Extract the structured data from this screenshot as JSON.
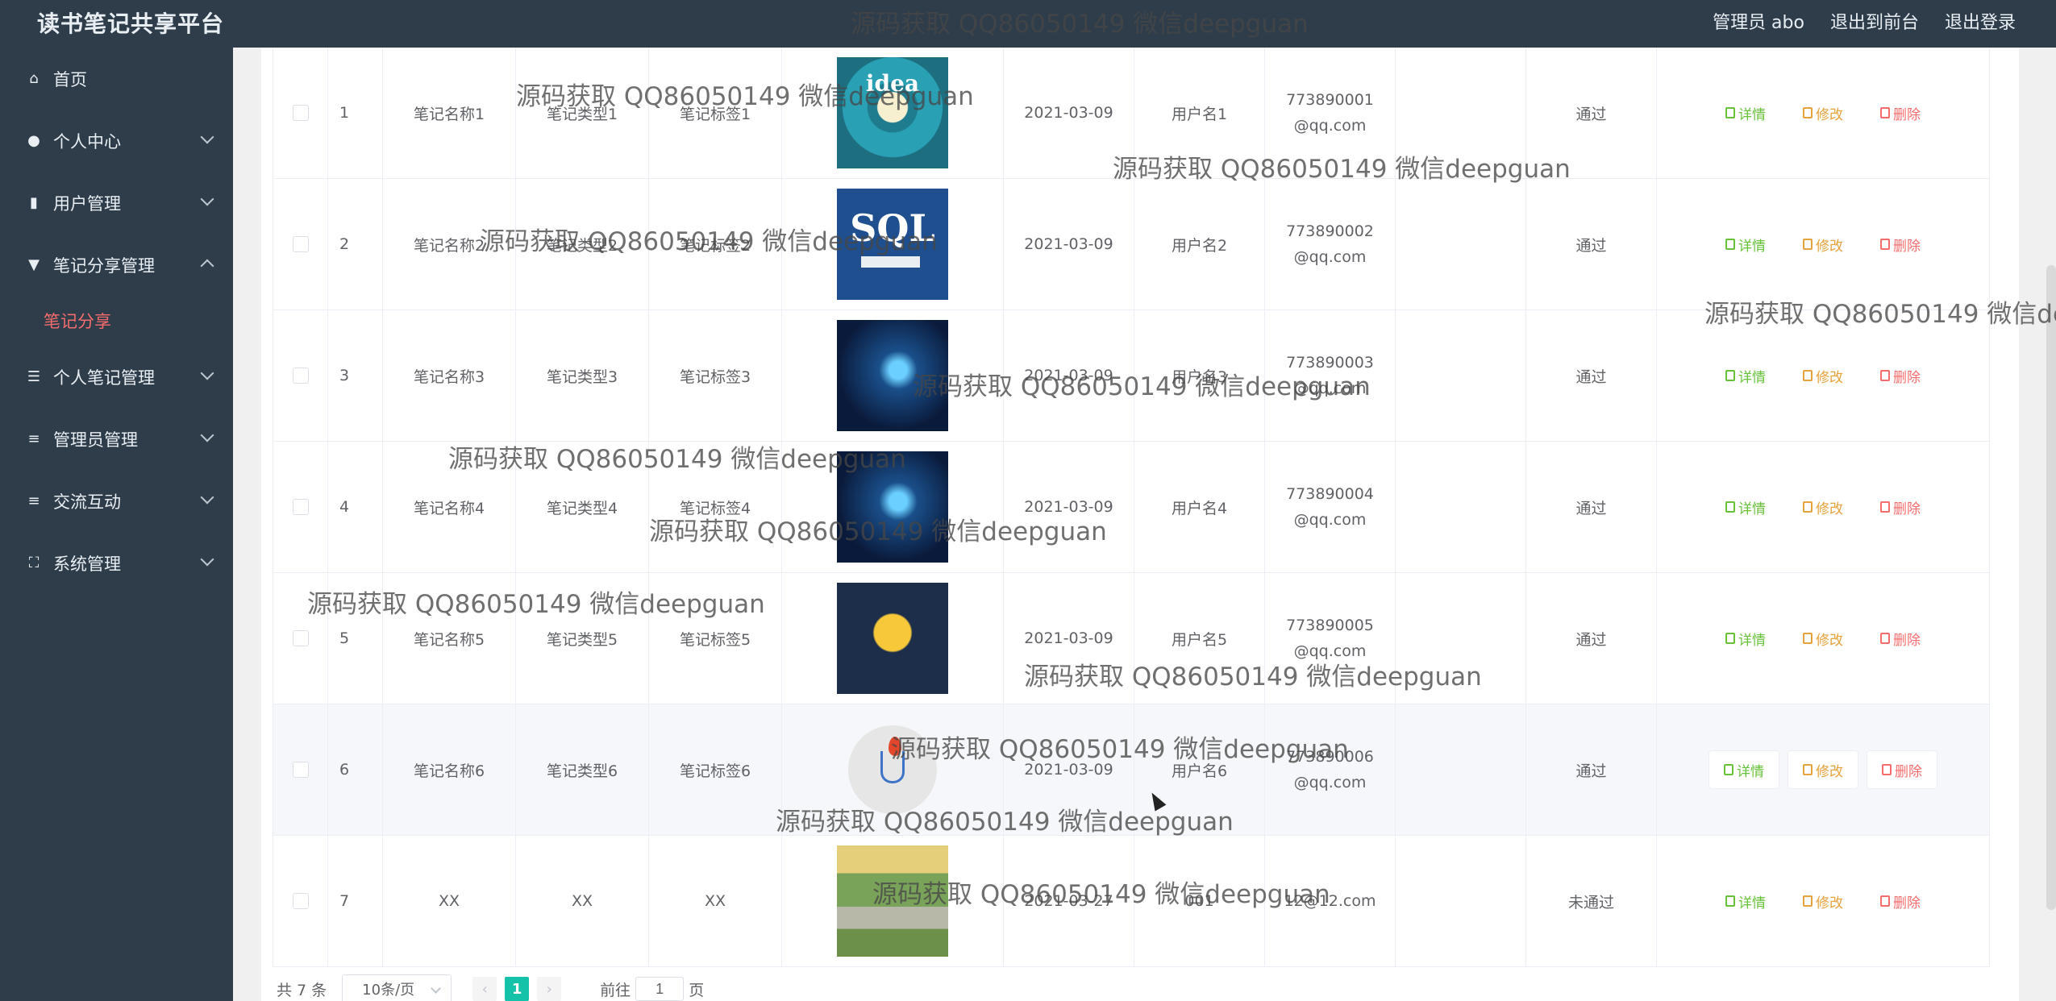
{
  "app": {
    "title": "读书笔记共享平台",
    "header_links": [
      "管理员 abo",
      "退出到前台",
      "退出登录"
    ]
  },
  "sidebar": {
    "items": [
      {
        "label": "首页",
        "icon": "home-icon",
        "expandable": false
      },
      {
        "label": "个人中心",
        "icon": "user-icon",
        "expandable": true
      },
      {
        "label": "用户管理",
        "icon": "chart-icon",
        "expandable": true
      },
      {
        "label": "笔记分享管理",
        "icon": "brush-icon",
        "expandable": true,
        "expanded": true
      },
      {
        "label": "个人笔记管理",
        "icon": "sliders-icon",
        "expandable": true
      },
      {
        "label": "管理员管理",
        "icon": "list-icon",
        "expandable": true
      },
      {
        "label": "交流互动",
        "icon": "lines-icon",
        "expandable": true
      },
      {
        "label": "系统管理",
        "icon": "frame-icon",
        "expandable": true
      }
    ],
    "active_sub": "笔记分享"
  },
  "table": {
    "rows": [
      {
        "idx": "1",
        "name": "笔记名称1",
        "type": "笔记类型1",
        "tag": "笔记标签1",
        "img": "t1",
        "date": "2021-03-09",
        "user": "用户名1",
        "email": "773890001@qq.com",
        "status": "通过"
      },
      {
        "idx": "2",
        "name": "笔记名称2",
        "type": "笔记类型2",
        "tag": "笔记标签2",
        "img": "t2",
        "date": "2021-03-09",
        "user": "用户名2",
        "email": "773890002@qq.com",
        "status": "通过"
      },
      {
        "idx": "3",
        "name": "笔记名称3",
        "type": "笔记类型3",
        "tag": "笔记标签3",
        "img": "t3",
        "date": "2021-03-09",
        "user": "用户名3",
        "email": "773890003@qq.com",
        "status": "通过"
      },
      {
        "idx": "4",
        "name": "笔记名称4",
        "type": "笔记类型4",
        "tag": "笔记标签4",
        "img": "t4",
        "date": "2021-03-09",
        "user": "用户名4",
        "email": "773890004@qq.com",
        "status": "通过"
      },
      {
        "idx": "5",
        "name": "笔记名称5",
        "type": "笔记类型5",
        "tag": "笔记标签5",
        "img": "t5",
        "date": "2021-03-09",
        "user": "用户名5",
        "email": "773890005@qq.com",
        "status": "通过"
      },
      {
        "idx": "6",
        "name": "笔记名称6",
        "type": "笔记类型6",
        "tag": "笔记标签6",
        "img": "t6",
        "date": "2021-03-09",
        "user": "用户名6",
        "email": "773890006@qq.com",
        "status": "通过"
      },
      {
        "idx": "7",
        "name": "XX",
        "type": "XX",
        "tag": "XX",
        "img": "t7",
        "date": "2021-03-27",
        "user": "001",
        "email": "12@12.com",
        "status": "未通过"
      }
    ],
    "ops": {
      "detail": "详情",
      "edit": "修改",
      "delete": "删除"
    },
    "thumb_text": {
      "t1": "idea",
      "t2": "SQL"
    }
  },
  "pager": {
    "total": "共 7 条",
    "page_size": "10条/页",
    "current_page": "1",
    "goto_prefix": "前往",
    "goto_value": "1",
    "goto_suffix": "页"
  },
  "watermark": "源码获取 QQ86050149 微信deepguan",
  "colors": {
    "sidebar_bg": "#2f3d4b",
    "active_sub": "#f56c6c",
    "page_active": "#13c2a8",
    "detail": "#67c23a",
    "edit": "#e6a23c",
    "delete": "#f56c6c"
  }
}
